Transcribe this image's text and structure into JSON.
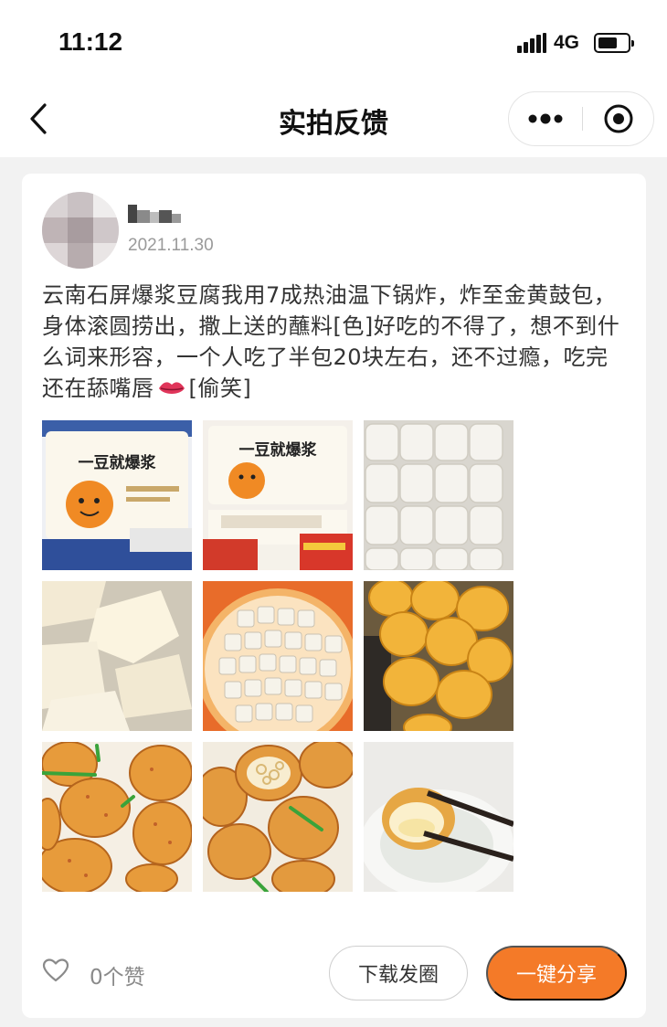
{
  "status_bar": {
    "time": "11:12",
    "network": "4G",
    "battery_level": 0.65
  },
  "nav": {
    "title": "实拍反馈",
    "back_icon": "chevron-left-icon",
    "more_icon": "more-dots-icon",
    "close_icon": "target-close-icon"
  },
  "post": {
    "username": "",
    "date": "2021.11.30",
    "text_before_emoji": "云南石屏爆浆豆腐我用7成热油温下锅炸，炸至金黄鼓包，身体滚圆捞出，撒上送的蘸料[色]好吃的不得了，想不到什么词来形容，一个人吃了半包20块左右，还不过瘾，吃完还在舔嘴唇",
    "emoji_icon": "lips-icon",
    "text_after_emoji": "[偷笑]",
    "photos": [
      {
        "subject": "package-photo",
        "package_text": "一豆就爆浆"
      },
      {
        "subject": "package-photo",
        "package_text": "一豆就爆浆"
      },
      {
        "subject": "raw-tofu-tray"
      },
      {
        "subject": "raw-tofu-closeup"
      },
      {
        "subject": "tofu-cubes-plate"
      },
      {
        "subject": "fried-tofu-balls"
      },
      {
        "subject": "seasoned-fried-tofu"
      },
      {
        "subject": "seasoned-fried-tofu-cut"
      },
      {
        "subject": "tofu-with-chopsticks"
      }
    ]
  },
  "footer": {
    "like_icon": "heart-outline-icon",
    "like_count": "0个赞",
    "download_label": "下载发圈",
    "share_label": "一键分享"
  },
  "colors": {
    "accent": "#f47a28",
    "background": "#f2f2f2",
    "card": "#ffffff"
  }
}
